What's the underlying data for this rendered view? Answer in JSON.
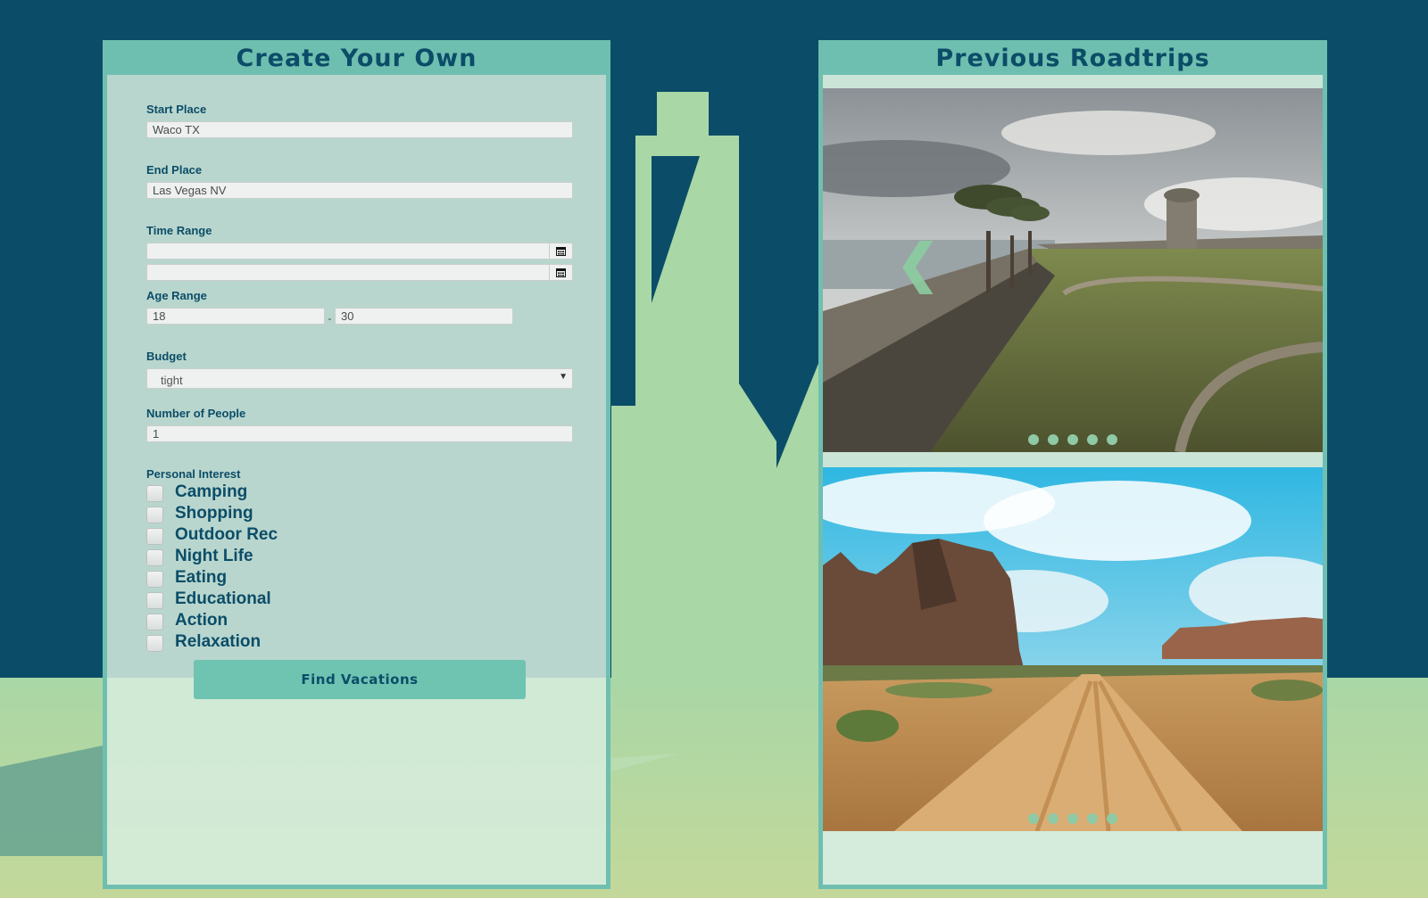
{
  "left_panel": {
    "title": "Create Your Own",
    "start_place": {
      "label": "Start Place",
      "value": "Waco TX"
    },
    "end_place": {
      "label": "End Place",
      "value": "Las Vegas NV"
    },
    "time_range": {
      "label": "Time Range",
      "start_value": "",
      "end_value": ""
    },
    "age_range": {
      "label": "Age Range",
      "min": "18",
      "max": "30",
      "separator": "-"
    },
    "budget": {
      "label": "Budget",
      "selected": "tight"
    },
    "people": {
      "label": "Number of People",
      "value": "1"
    },
    "interests": {
      "label": "Personal Interest",
      "items": [
        "Camping",
        "Shopping",
        "Outdoor Rec",
        "Night Life",
        "Eating",
        "Educational",
        "Action",
        "Relaxation"
      ]
    },
    "submit_label": "Find Vacations"
  },
  "right_panel": {
    "title": "Previous Roadtrips",
    "carousels": [
      {
        "dot_count": 5,
        "prev_glyph": "❮"
      },
      {
        "dot_count": 5
      }
    ]
  },
  "colors": {
    "sky": "#0b4d68",
    "accent": "#6fbfb0",
    "panel_bg": "#d6ece0",
    "text": "#0b4d68",
    "ground": "#a9d7a6"
  }
}
